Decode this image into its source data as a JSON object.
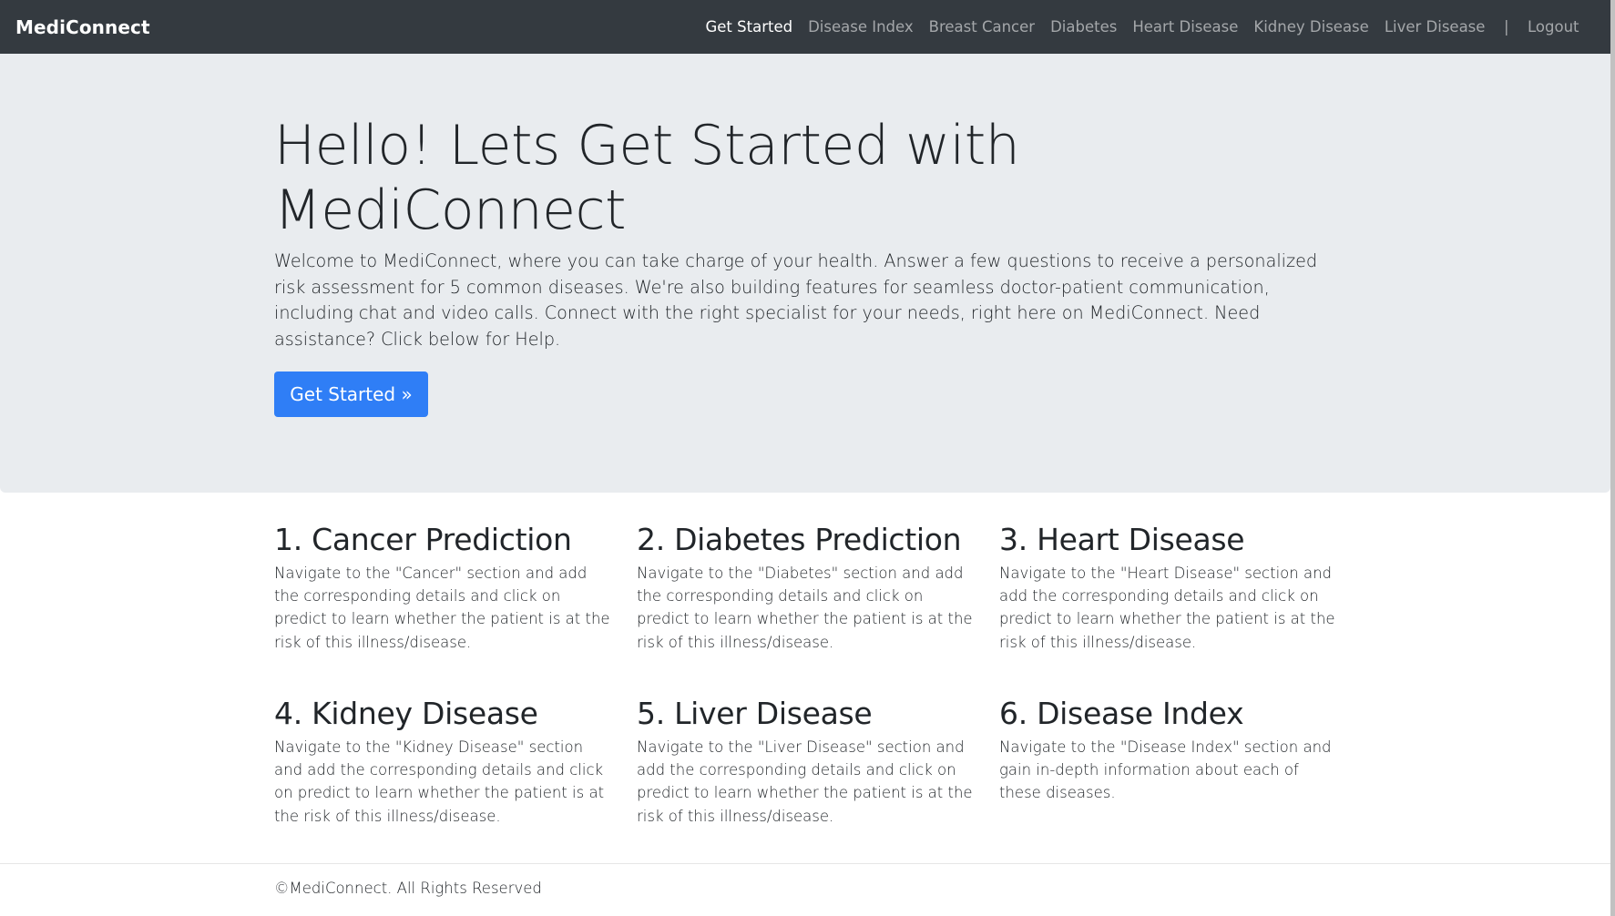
{
  "navbar": {
    "brand": "MediConnect",
    "links": [
      {
        "label": "Get Started",
        "active": true
      },
      {
        "label": "Disease Index",
        "active": false
      },
      {
        "label": "Breast Cancer",
        "active": false
      },
      {
        "label": "Diabetes",
        "active": false
      },
      {
        "label": "Heart Disease",
        "active": false
      },
      {
        "label": "Kidney Disease",
        "active": false
      },
      {
        "label": "Liver Disease",
        "active": false
      }
    ],
    "separator": "|",
    "logout": "Logout"
  },
  "hero": {
    "title": "Hello! Lets Get Started with MediConnect",
    "lead": "Welcome to MediConnect, where you can take charge of your health. Answer a few questions to receive a personalized risk assessment for 5 common diseases. We're also building features for seamless doctor-patient communication, including chat and video calls. Connect with the right specialist for your needs, right here on MediConnect. Need assistance? Click below for Help.",
    "button": "Get Started »"
  },
  "features": [
    {
      "title": "1. Cancer Prediction",
      "text": "Navigate to the \"Cancer\" section and add the corresponding details and click on predict to learn whether the patient is at the risk of this illness/disease."
    },
    {
      "title": "2. Diabetes Prediction",
      "text": "Navigate to the \"Diabetes\" section and add the corresponding details and click on predict to learn whether the patient is at the risk of this illness/disease."
    },
    {
      "title": "3. Heart Disease",
      "text": "Navigate to the \"Heart Disease\" section and add the corresponding details and click on predict to learn whether the patient is at the risk of this illness/disease."
    },
    {
      "title": "4. Kidney Disease",
      "text": "Navigate to the \"Kidney Disease\" section and add the corresponding details and click on predict to learn whether the patient is at the risk of this illness/disease."
    },
    {
      "title": "5. Liver Disease",
      "text": "Navigate to the \"Liver Disease\" section and add the corresponding details and click on predict to learn whether the patient is at the risk of this illness/disease."
    },
    {
      "title": "6. Disease Index",
      "text": "Navigate to the \"Disease Index\" section and gain in-depth information about each of these diseases."
    }
  ],
  "footer": {
    "text": "©MediConnect. All Rights Reserved"
  },
  "colors": {
    "navbar": "#343a40",
    "jumbotron": "#e9ecef",
    "primary_button": "#2f7ef6"
  }
}
